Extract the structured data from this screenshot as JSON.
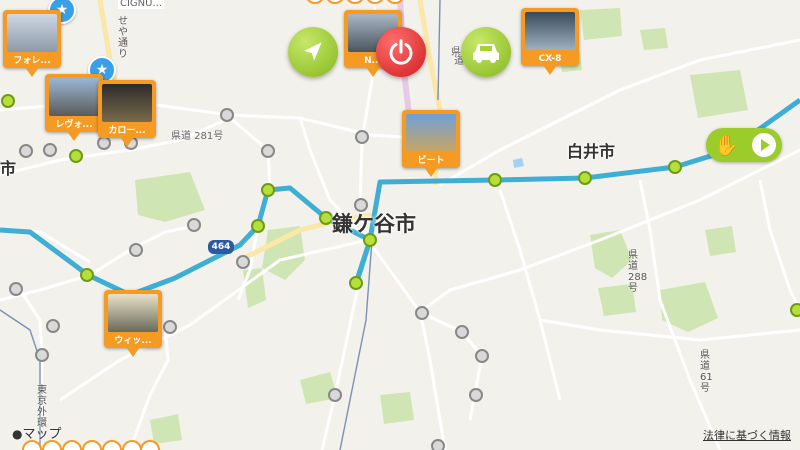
{
  "places": [
    {
      "id": "kamagaya",
      "name": "鎌ケ谷市"
    },
    {
      "id": "shiroi",
      "name": "白井市"
    },
    {
      "id": "left",
      "name": "市"
    }
  ],
  "road_labels": {
    "kendo281": "県道 281号",
    "kendo_top": "県道",
    "kendo_top2": "道 28",
    "cigno": "CIGNU..."
  },
  "vertical_labels": {
    "tokyo_gaikan": "東京外環",
    "kendo288": "県道288号",
    "kendo61": "県道61号",
    "road_top": "せや通り"
  },
  "road_shield": "464",
  "photo_pins": [
    {
      "id": "fore",
      "caption": "フォレ...",
      "colors": [
        "#cfd8e3",
        "#8d9aa8"
      ]
    },
    {
      "id": "levorg",
      "caption": "レヴォ...",
      "colors": [
        "#9bb6d4",
        "#5a5a5a"
      ]
    },
    {
      "id": "carol",
      "caption": "カロー...",
      "colors": [
        "#2c2c2c",
        "#7a6a4a"
      ]
    },
    {
      "id": "n",
      "caption": "N...",
      "colors": [
        "#aab7c4",
        "#4a5560"
      ]
    },
    {
      "id": "cx8",
      "caption": "CX-8",
      "colors": [
        "#3a4a5a",
        "#9fb0c0"
      ]
    },
    {
      "id": "beat",
      "caption": "ビート",
      "colors": [
        "#6fa0d8",
        "#c9a660"
      ]
    },
    {
      "id": "witz",
      "caption": "ウィッ...",
      "colors": [
        "#e8e2c8",
        "#6a6a5a"
      ]
    }
  ],
  "buttons": {
    "navigate_icon": "location-arrow-icon",
    "power_icon": "power-icon",
    "car_icon": "car-icon",
    "hand_icon": "hand-icon",
    "play_icon": "play-icon"
  },
  "brand": "マップ",
  "attribution": "法律に基づく情報",
  "colors": {
    "route": "#2aa6d1",
    "pin": "#f59a23",
    "accent_green": "#9ccc2a",
    "power": "#d11d1d",
    "favorite": "#39a0e8"
  }
}
